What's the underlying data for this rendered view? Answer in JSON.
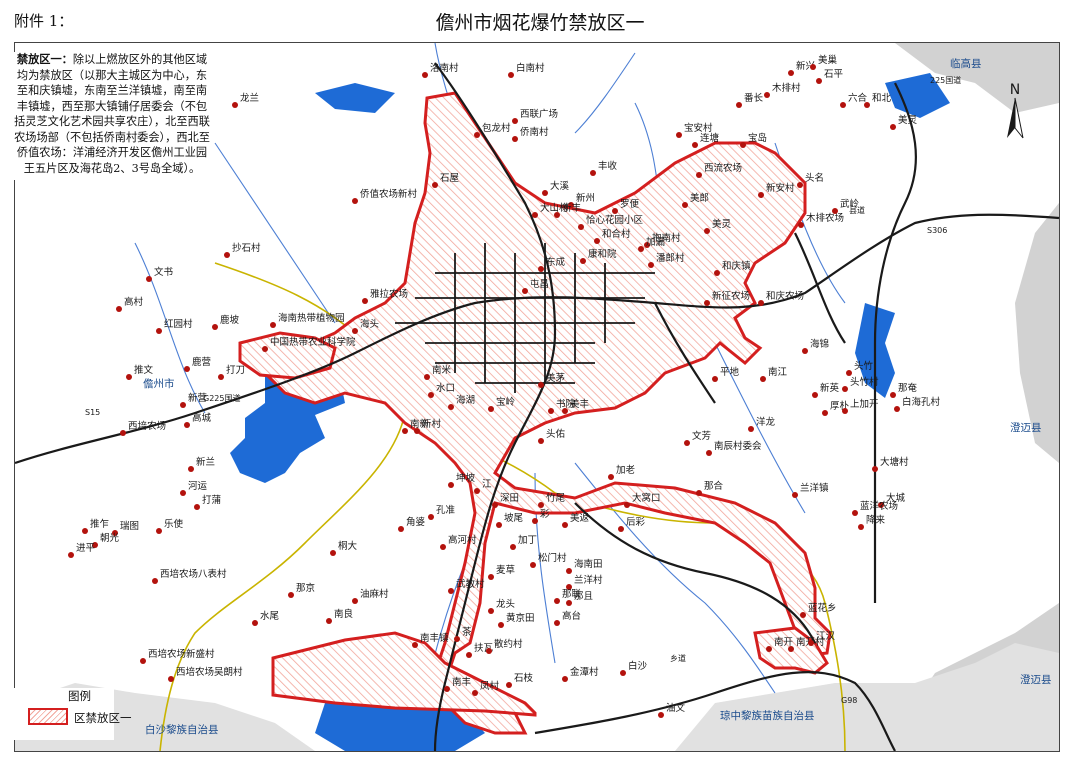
{
  "header": {
    "attachment": "附件 1：",
    "title": "儋州市烟花爆竹禁放区一"
  },
  "description": {
    "lead": "禁放区一：",
    "body": "除以上燃放区外的其他区域均为禁放区（以那大主城区为中心，东至和庆镇墟，东南至兰洋镇墟，南至南丰镇墟，西至那大镇铺仔居委会（不包括灵芝文化艺术园共享农庄），北至西联农场场部（不包括侨南村委会），西北至侨值农场：洋浦经济开发区儋州工业园王五片区及海花岛2、3号岛全域）。"
  },
  "legend": {
    "title": "图例",
    "item_label": "区禁放区一"
  },
  "compass": {
    "letter": "N"
  },
  "colors": {
    "zone_border": "#d41f1f",
    "zone_hatch": "#f2a79c",
    "water": "#1e6bd6",
    "river": "#4d7fd4",
    "roads": "#1a1a1a",
    "highway": "#c9b400",
    "neighbor_area": "#d2d2d2",
    "place_dot": "#b3120d"
  },
  "map": {
    "county_labels": [
      "临高县",
      "澄迈县",
      "澄迈县",
      "白沙黎族自治县",
      "琼中黎族苗族自治县",
      "儋州市"
    ],
    "road_labels": [
      "225国道",
      "S15",
      "G225国道",
      "S306",
      "县道",
      "G98",
      "乡道"
    ],
    "places": [
      "洛南村",
      "白南村",
      "新兴",
      "美巢",
      "石平",
      "木排村",
      "番长",
      "六合",
      "和北",
      "美灵",
      "龙兰",
      "包龙村",
      "西联广场",
      "侨南村",
      "宝安村",
      "丰收",
      "连塘",
      "宝岛",
      "西流农场",
      "新安村",
      "头名",
      "木排农场",
      "石屋",
      "武岭",
      "侨值农场新村",
      "大溪",
      "新州",
      "大山村",
      "新丰",
      "恰心花园小区",
      "罗便",
      "美郎",
      "和合村",
      "抱南村",
      "美灵",
      "加漏",
      "潘郎村",
      "东成",
      "康和院",
      "和庆镇",
      "新征农场",
      "和庆农场",
      "抄石村",
      "文书",
      "高村",
      "海南热带植物园",
      "雅拉农场",
      "屯昌",
      "红园村",
      "鹿坡",
      "中国热带农业科学院",
      "海头",
      "推文",
      "鹿营",
      "打刀",
      "新营",
      "南米",
      "水口",
      "海湖",
      "宝岭",
      "新村",
      "南新",
      "美茅",
      "书院",
      "平地",
      "南江",
      "头竹",
      "海锦",
      "新英",
      "头竹村",
      "厚朴",
      "上加开",
      "那奄",
      "白海孔村",
      "西培农场",
      "高城",
      "美丰",
      "头佑",
      "文芳",
      "洋龙",
      "南辰村委会",
      "新兰",
      "坤坡",
      "加老",
      "大塘村",
      "河运",
      "打蒲",
      "兰洋镇",
      "那合",
      "大城",
      "江",
      "深田",
      "竹尾",
      "美返",
      "大窝口",
      "蓝洋农场",
      "降来",
      "推乍",
      "瑞图",
      "乐使",
      "朝光",
      "孔准",
      "坡尾",
      "彩",
      "后彩",
      "角婆",
      "高河村",
      "加丁",
      "进平",
      "桐大",
      "松门村",
      "海南田",
      "兰洋村",
      "西培农场八表村",
      "那京",
      "油麻村",
      "武教村",
      "麦草",
      "那且",
      "水尾",
      "南良",
      "龙头",
      "黄京田",
      "那联",
      "高台",
      "蓝花乡",
      "南开",
      "南开村",
      "江汉",
      "西培农场新盛村",
      "南丰镇",
      "茶",
      "扶瓦",
      "散约村",
      "石枝",
      "金潭村",
      "西培农场吴朗村",
      "白沙",
      "南丰",
      "凤村",
      "油文"
    ]
  }
}
